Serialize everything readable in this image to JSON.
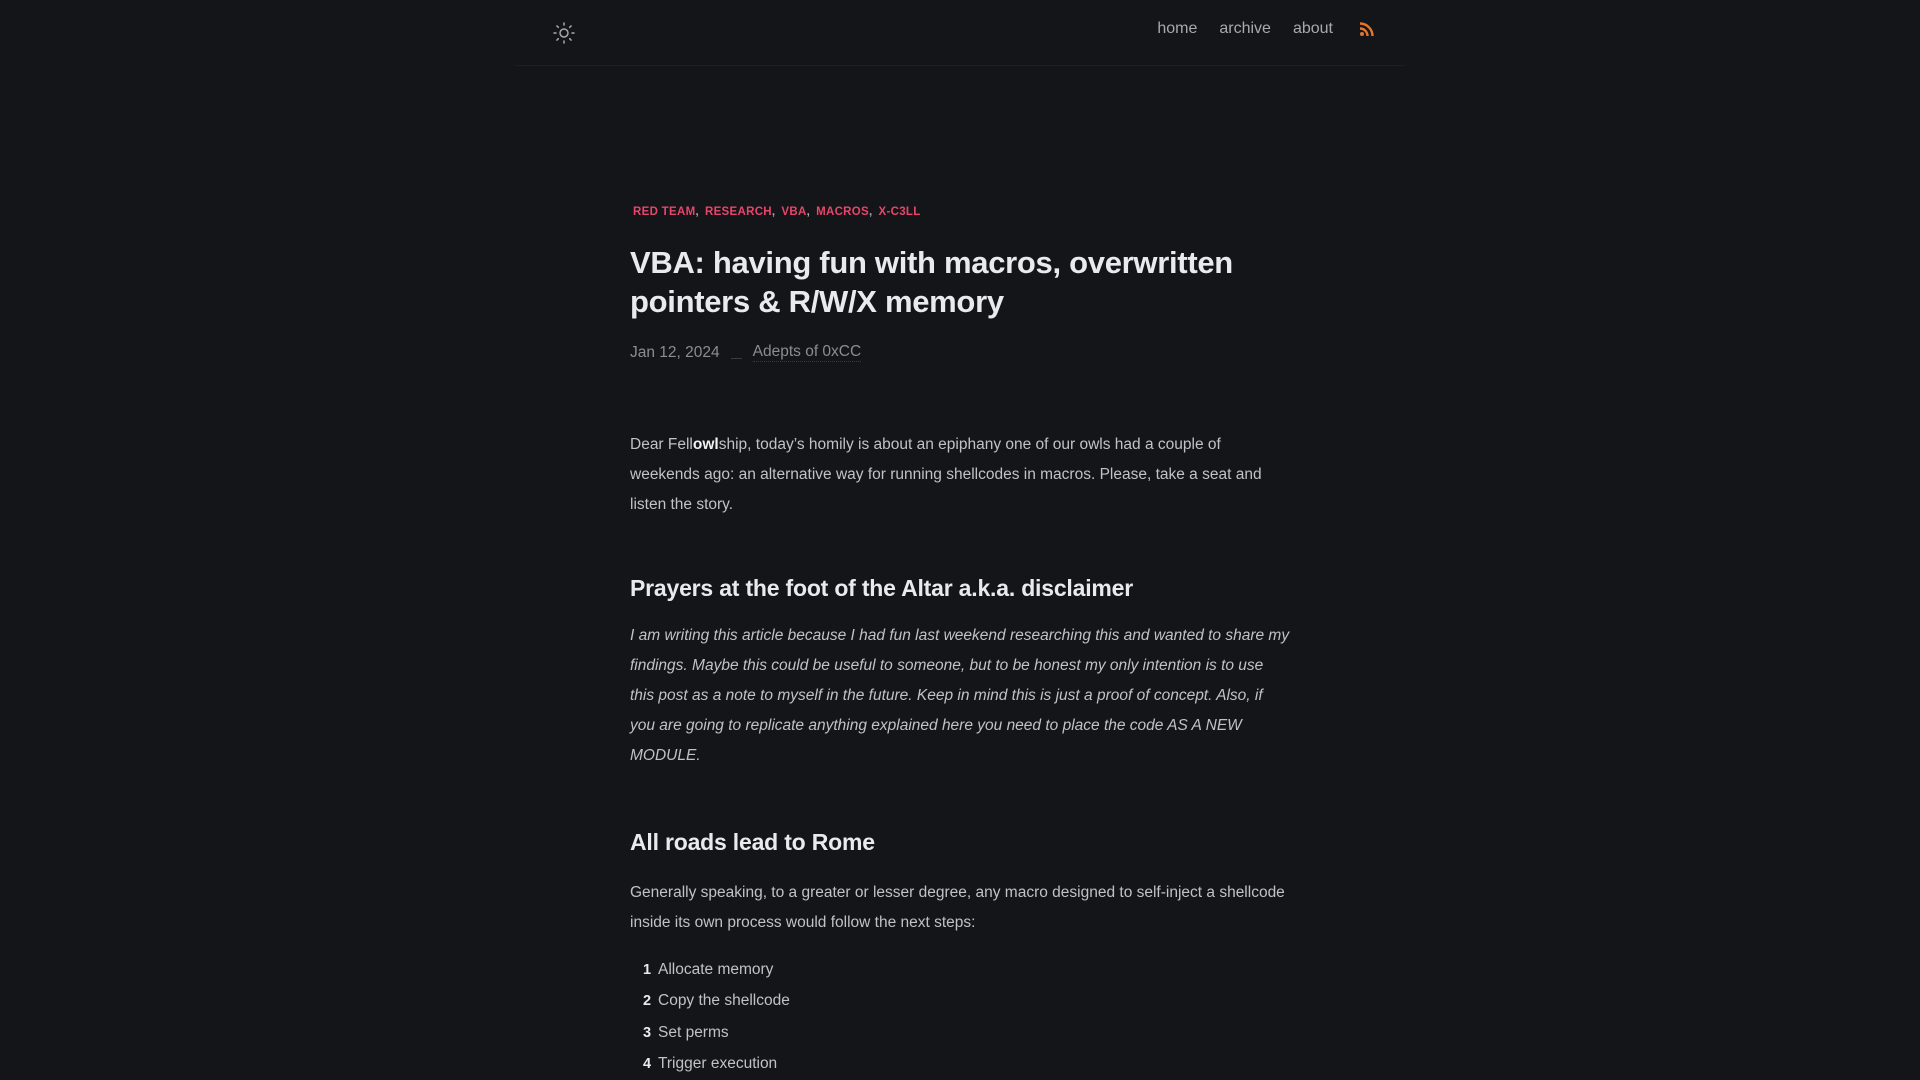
{
  "header": {
    "theme_toggle_icon": "sun-icon",
    "nav": [
      {
        "label": "home"
      },
      {
        "label": "archive"
      },
      {
        "label": "about"
      }
    ],
    "rss_icon": "rss-icon",
    "rss_color": "#e0762b"
  },
  "article": {
    "tags": [
      "RED TEAM",
      "RESEARCH",
      "VBA",
      "MACROS",
      "X-C3LL"
    ],
    "tag_color": "#e8456b",
    "title": "VBA: having fun with macros, overwritten pointers & R/W/X memory",
    "date": "Jan 12, 2024",
    "author": "Adepts of 0xCC",
    "intro": {
      "before": "Dear Fell",
      "bold": "owl",
      "after": "ship, today’s homily is about an epiphany one of our owls had a couple of weekends ago: an alternative way for running shellcodes in macros. Please, take a seat and listen the story."
    },
    "sections": [
      {
        "heading": "Prayers at the foot of the Altar a.k.a. disclaimer",
        "text": "I am writing this article because I had fun last weekend researching this and wanted to share my findings. Maybe this could be useful to someone, but to be honest my only intention is to use this post as a note to myself in the future. Keep in mind this is just a proof of concept. Also, if you are going to replicate anything explained here you need to place the code AS A NEW MODULE."
      },
      {
        "heading": "All roads lead to Rome",
        "text": "Generally speaking, to a greater or lesser degree, any macro designed to self-inject a shellcode inside its own process would follow the next steps:",
        "steps": [
          {
            "num": "1",
            "label": "Allocate memory"
          },
          {
            "num": "2",
            "label": "Copy the shellcode"
          },
          {
            "num": "3",
            "label": "Set perms"
          },
          {
            "num": "4",
            "label": "Trigger execution"
          }
        ]
      }
    ]
  }
}
